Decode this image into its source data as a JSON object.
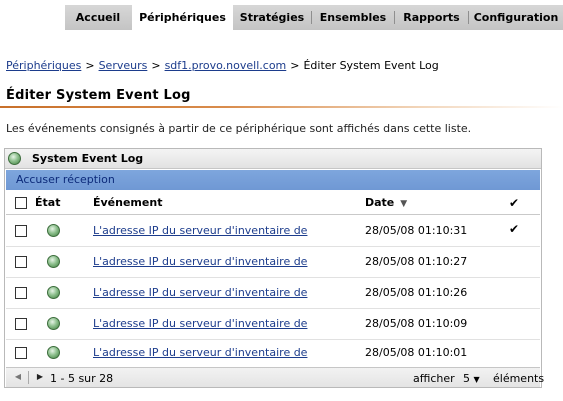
{
  "nav": {
    "tabs": [
      {
        "label": "Accueil",
        "active": false
      },
      {
        "label": "Périphériques",
        "active": true
      },
      {
        "label": "Stratégies",
        "active": false
      },
      {
        "label": "Ensembles",
        "active": false
      },
      {
        "label": "Rapports",
        "active": false
      },
      {
        "label": "Configuration",
        "active": false
      }
    ]
  },
  "breadcrumb": {
    "items": [
      "Périphériques",
      "Serveurs",
      "sdf1.provo.novell.com"
    ],
    "separator": ">",
    "current": "Éditer System Event Log"
  },
  "page": {
    "title": "Éditer System Event Log",
    "description": "Les événements consignés à partir de ce périphérique sont affichés dans cette liste."
  },
  "panel": {
    "title": "System Event Log",
    "acknowledge_label": "Accuser réception",
    "columns": {
      "state": "État",
      "event": "Événement",
      "date": "Date",
      "sort_icon": "sort-descending-icon",
      "ack": "✔"
    },
    "rows": [
      {
        "event": "L'adresse IP du serveur d'inventaire de",
        "date": "28/05/08 01:10:31",
        "ack": "✔"
      },
      {
        "event": "L'adresse IP du serveur d'inventaire de",
        "date": "28/05/08 01:10:27",
        "ack": ""
      },
      {
        "event": "L'adresse IP du serveur d'inventaire de",
        "date": "28/05/08 01:10:26",
        "ack": ""
      },
      {
        "event": "L'adresse IP du serveur d'inventaire de",
        "date": "28/05/08 01:10:09",
        "ack": ""
      },
      {
        "event": "L'adresse IP du serveur d'inventaire de",
        "date": "28/05/08 01:10:01",
        "ack": ""
      }
    ],
    "pagination": {
      "range": "1 - 5 sur 28",
      "show_label": "afficher",
      "page_size": "5",
      "items_label": "éléments"
    }
  },
  "colors": {
    "link": "#1c3c8c",
    "ack_bar": "#7ea6dd",
    "title_rule": "#c8702a",
    "status_ok": "#3e7f3e"
  }
}
